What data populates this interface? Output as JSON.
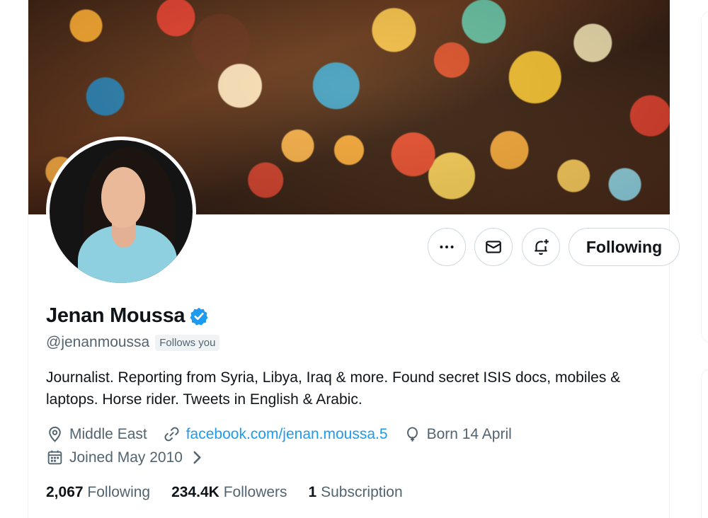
{
  "profile": {
    "display_name": "Jenan Moussa",
    "handle": "@jenanmoussa",
    "follows_you": "Follows you",
    "bio": "Journalist. Reporting from Syria, Libya, Iraq & more. Found secret ISIS docs, mobiles & laptops. Horse rider. Tweets in English & Arabic.",
    "location": "Middle East",
    "website": "facebook.com/jenan.moussa.5",
    "birthday": "Born 14 April",
    "joined": "Joined May 2010"
  },
  "actions": {
    "following_label": "Following",
    "more_icon": "more-horizontal-icon",
    "message_icon": "mail-icon",
    "notify_icon": "bell-plus-icon"
  },
  "stats": {
    "following_count": "2,067",
    "following_label": "Following",
    "followers_count": "234.4K",
    "followers_label": "Followers",
    "subscription_count": "1",
    "subscription_label": "Subscription"
  },
  "colors": {
    "accent": "#1d9bf0",
    "secondary_text": "#536471",
    "primary_text": "#0f1419",
    "border": "#cfd9de"
  }
}
